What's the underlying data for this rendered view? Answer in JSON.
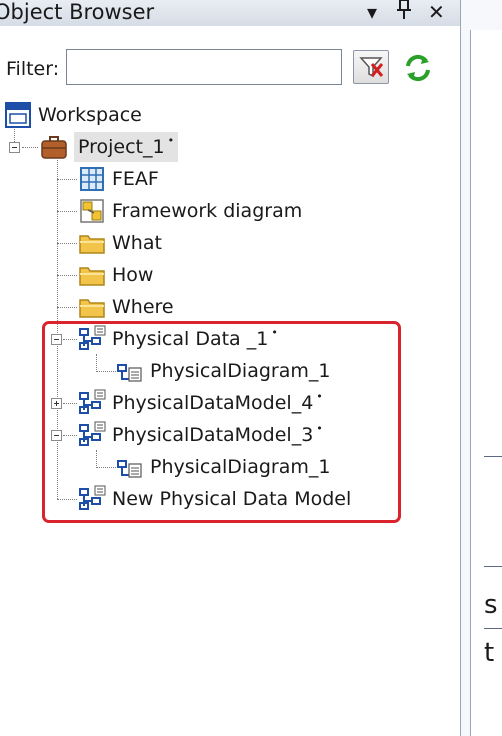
{
  "window": {
    "title": "Object Browser"
  },
  "filter": {
    "label": "Filter:",
    "value": "",
    "placeholder": ""
  },
  "tree": {
    "workspace": "Workspace",
    "project": {
      "label": "Project_1",
      "mark": "•"
    },
    "feaf": "FEAF",
    "framework_diagram": "Framework diagram",
    "what": "What",
    "how": "How",
    "where": "Where",
    "physical_data": {
      "label": "Physical Data _1",
      "mark": "•"
    },
    "physical_diagram_1a": "PhysicalDiagram_1",
    "model_4": {
      "label": "PhysicalDataModel_4",
      "mark": "•"
    },
    "model_3": {
      "label": "PhysicalDataModel_3",
      "mark": "•"
    },
    "physical_diagram_1b": "PhysicalDiagram_1",
    "new_model": "New Physical Data Model"
  },
  "right_pane": {
    "letter_1": "s",
    "letter_2": "t"
  },
  "colors": {
    "highlight": "#d9232d",
    "folder": "#f3c44a",
    "model": "#1d4fa8"
  }
}
